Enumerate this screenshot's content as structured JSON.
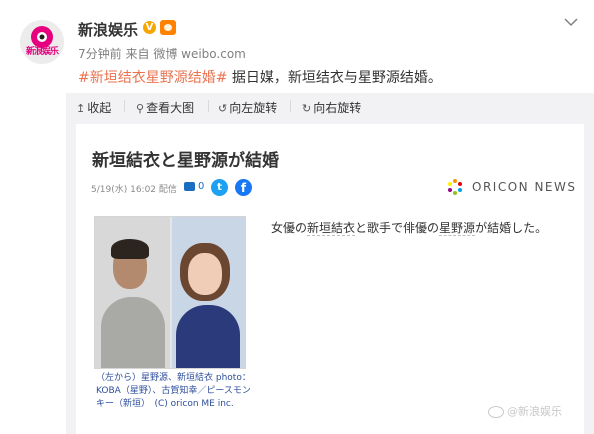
{
  "post": {
    "author": "新浪娱乐",
    "avatar_text": "新浪娱乐",
    "verified_badge": "V",
    "time": "7分钟前",
    "source_prefix": "来自",
    "source": "微博 weibo.com",
    "hashtag": "#新垣结衣星野源结婚#",
    "text": " 据日媒，新垣结衣与星野源结婚。",
    "menu_icon": "chevron-down-icon"
  },
  "toolbar": {
    "collect": "收起",
    "view_large": "查看大图",
    "rotate_left": "向左旋转",
    "rotate_right": "向右旋转"
  },
  "article": {
    "title": "新垣結衣と星野源が結婚",
    "date": "5/19(水) 16:02 配信",
    "comment_count": "0",
    "twitter_letter": "t",
    "facebook_letter": "f",
    "brand": "ORICON NEWS",
    "body_pre": "女優の",
    "body_name1": "新垣結衣",
    "body_mid": "と歌手で俳優の",
    "body_name2": "星野源",
    "body_post": "が結婚した。",
    "caption": "（左から）星野源、新垣結衣 photo：KOBA（星野）、古賀知幸／ピースモンキー（新垣）　(C) oricon ME inc."
  },
  "watermark": "@新浪娱乐",
  "colors": {
    "hashtag": "#eb7350",
    "twitter": "#1da1f2",
    "facebook": "#1877f2",
    "caption": "#2d4e9c"
  }
}
